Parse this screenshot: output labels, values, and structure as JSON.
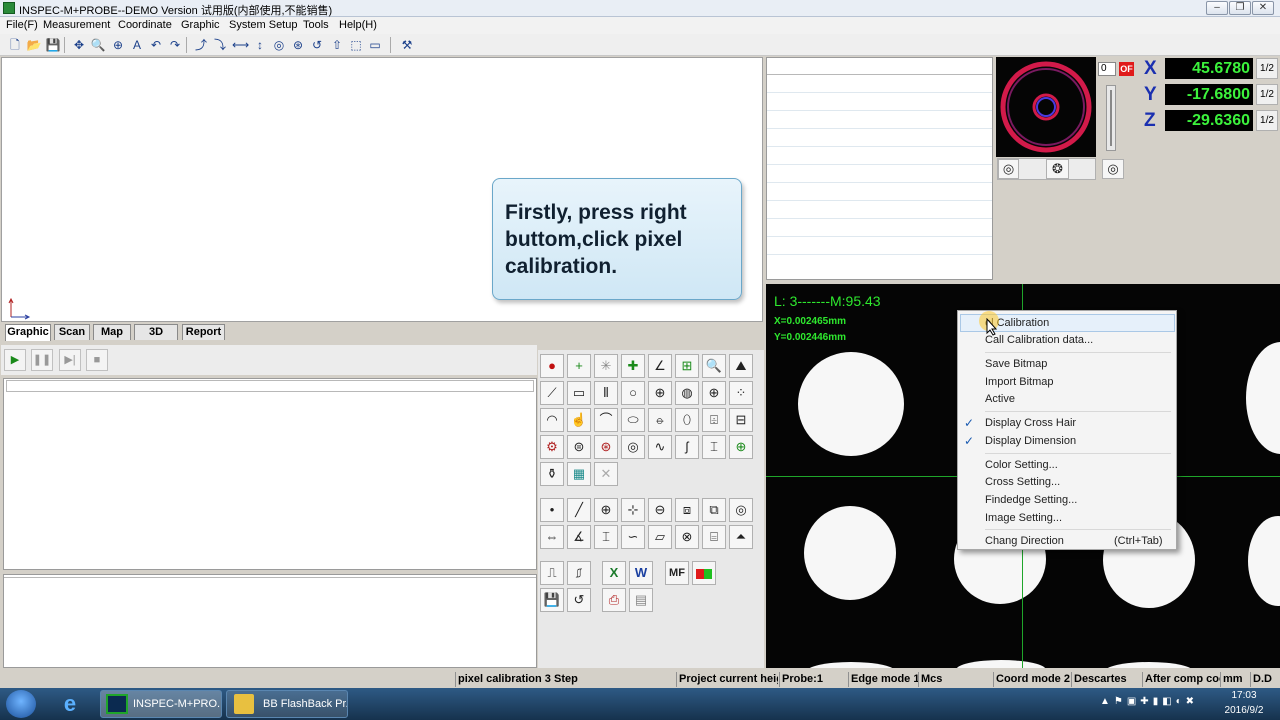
{
  "window": {
    "title": "INSPEC-M+PROBE--DEMO  Version  试用版(内部使用,不能销售)"
  },
  "menu": [
    "File(F)",
    "Measurement",
    "Coordinate",
    "Graphic",
    "System Setup",
    "Tools",
    "Help(H)"
  ],
  "tabs": [
    "Graphic",
    "Scan",
    "Map",
    "3D",
    "Report"
  ],
  "callout": {
    "text": "Firstly, press right buttom,click pixel calibration."
  },
  "coords": {
    "x": {
      "label": "X",
      "value": "45.6780",
      "frac": "1/2"
    },
    "y": {
      "label": "Y",
      "value": "-17.6800",
      "frac": "1/2"
    },
    "z": {
      "label": "Z",
      "value": "-29.6360",
      "frac": "1/2"
    }
  },
  "preview": {
    "spin_value": "0",
    "badge": "OF"
  },
  "camera": {
    "overlay_line1": "L: 3-------M:95.43",
    "overlay_x": "X=0.002465mm",
    "overlay_y": "Y=0.002446mm"
  },
  "context_menu": {
    "items": [
      {
        "label": "Pixel Calibration",
        "shown": "el Calibration"
      },
      {
        "label": "Call Calibration data..."
      },
      {
        "label": "Save Bitmap"
      },
      {
        "label": "Import Bitmap"
      },
      {
        "label": "Active"
      },
      {
        "label": "Display Cross Hair",
        "checked": true
      },
      {
        "label": "Display Dimension",
        "checked": true
      },
      {
        "label": "Color Setting..."
      },
      {
        "label": "Cross Setting..."
      },
      {
        "label": "Findedge Setting..."
      },
      {
        "label": "Image Setting..."
      },
      {
        "label": "Chang Direction",
        "shortcut": "(Ctrl+Tab)"
      }
    ]
  },
  "status": {
    "s1": "pixel calibration 3 Step",
    "s2": "Project current heig",
    "s3": "Probe:1",
    "s4": "Edge mode 1",
    "s5": "Mcs",
    "s6": "Coord mode 2",
    "s7": "Descartes",
    "s8": "After comp coo",
    "s9": "mm",
    "s10": "D.D"
  },
  "mf_label": "MF",
  "taskbar": {
    "app1": "INSPEC-M+PRO...",
    "app2": "BB FlashBack Pr...",
    "time": "17:03",
    "date": "2016/9/2"
  },
  "colors": {
    "readout_green": "#3cf23c",
    "crosshair": "#1fa52a",
    "callout_bg": "#d9eef8"
  }
}
